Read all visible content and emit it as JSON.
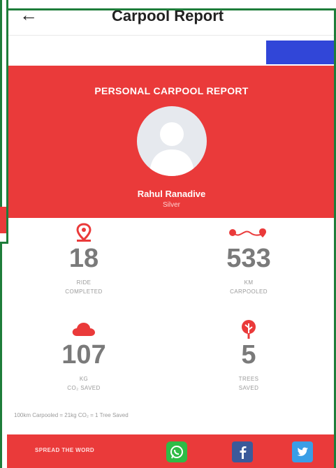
{
  "header": {
    "back_icon": "arrow-left-icon",
    "title": "Carpool Report"
  },
  "report": {
    "heading": "PERSONAL CARPOOL REPORT",
    "user_name": "Rahul Ranadive",
    "tier": "Silver"
  },
  "stats": [
    {
      "icon": "location-pin-icon",
      "value": "18",
      "label_line1": "RIDE",
      "label_line2": "COMPLETED"
    },
    {
      "icon": "route-icon",
      "value": "533",
      "label_line1": "KM",
      "label_line2": "CARPOOLED"
    },
    {
      "icon": "cloud-icon",
      "value": "107",
      "label_line1": "KG",
      "label_line2": "CO₂ SAVED"
    },
    {
      "icon": "tree-icon",
      "value": "5",
      "label_line1": "TREES",
      "label_line2": "SAVED"
    }
  ],
  "footnote": "100km Carpooled = 21kg CO₂ = 1 Tree Saved",
  "footer": {
    "label": "SPREAD THE WORD",
    "share_icons": [
      "whatsapp-icon",
      "facebook-icon",
      "twitter-icon"
    ]
  },
  "colors": {
    "accent_red": "#ea3a3a",
    "tab_blue": "#3146d8",
    "frame_green": "#1e7d3a"
  }
}
